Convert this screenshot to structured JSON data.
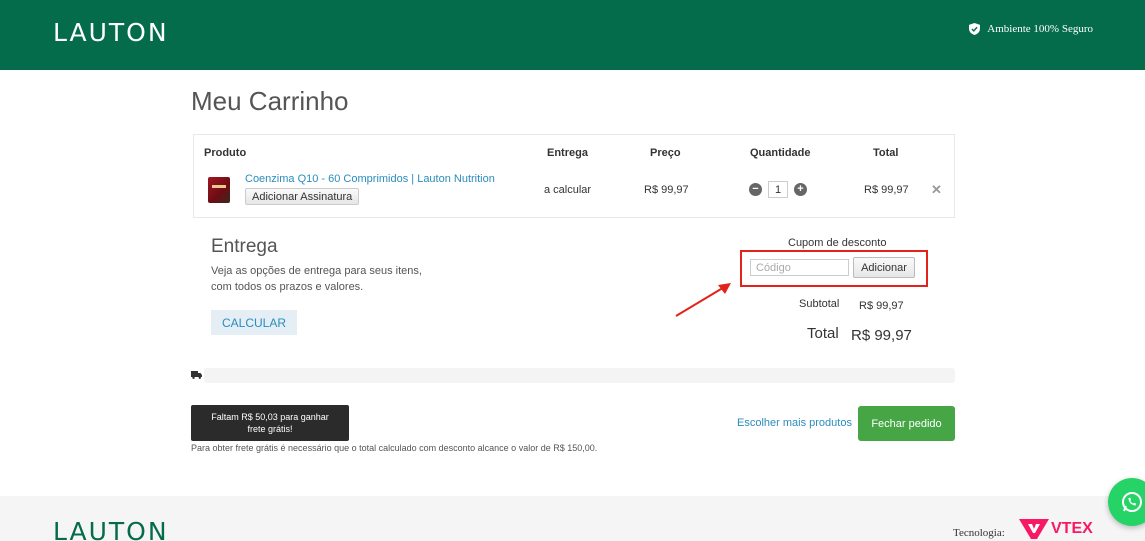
{
  "header": {
    "logo": "LAUTON",
    "secure_text": "Ambiente 100% Seguro"
  },
  "page": {
    "title": "Meu Carrinho"
  },
  "cart": {
    "columns": [
      "Produto",
      "Entrega",
      "Preço",
      "Quantidade",
      "Total"
    ],
    "item": {
      "name": "Coenzima Q10 - 60 Comprimidos | Lauton Nutrition",
      "subscription_button": "Adicionar Assinatura",
      "delivery": "a calcular",
      "price": "R$ 99,97",
      "quantity": "1",
      "total": "R$ 99,97"
    }
  },
  "shipping": {
    "title": "Entrega",
    "description": "Veja as opções de entrega para seus itens, com todos os prazos e valores.",
    "calculate_button": "CALCULAR"
  },
  "coupon": {
    "label": "Cupom de desconto",
    "placeholder": "Código",
    "add_button": "Adicionar"
  },
  "summary": {
    "subtotal_label": "Subtotal",
    "subtotal_value": "R$ 99,97",
    "total_label": "Total",
    "total_value": "R$ 99,97"
  },
  "free_shipping": {
    "progress": 0,
    "badge": "Faltam R$ 50,03 para ganhar frete grátis!",
    "note": "Para obter frete grátis é necessário que o total calculado com desconto alcance o valor de R$ 150,00."
  },
  "actions": {
    "more_products": "Escolher mais produtos",
    "checkout": "Fechar pedido"
  },
  "footer": {
    "logo": "LAUTON",
    "tech_label": "Tecnologia:",
    "vtex": "VTEX"
  },
  "colors": {
    "header_bg": "#046b4b",
    "link": "#2a8dbb",
    "checkout_bg": "#46a545",
    "highlight": "#e2231a"
  }
}
